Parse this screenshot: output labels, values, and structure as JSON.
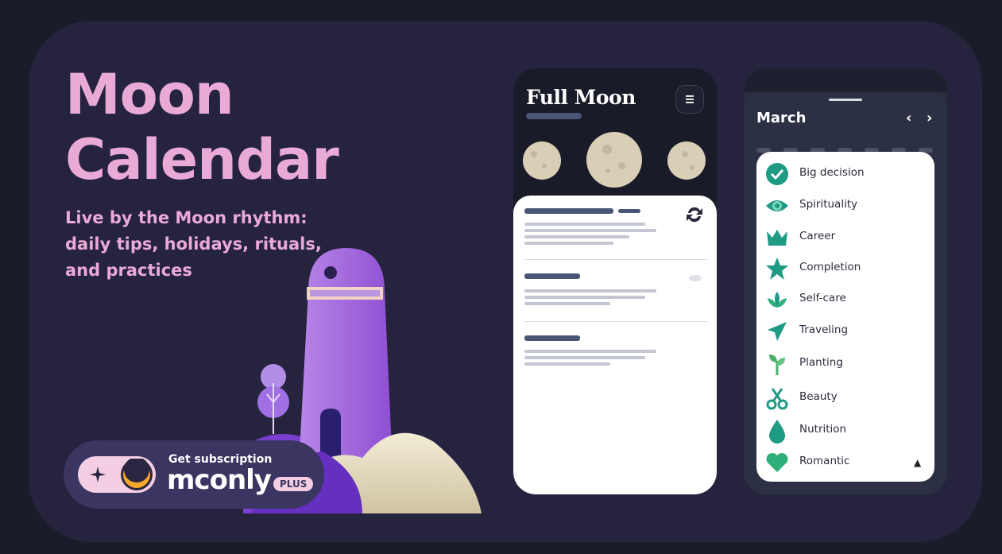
{
  "hero": {
    "title": "Moon\nCalendar",
    "subtitle": "Live by the Moon rhythm:\ndaily tips, holidays, rituals,\nand practices"
  },
  "subscription": {
    "label": "Get subscription",
    "brand": "mconly",
    "badge": "PLUS"
  },
  "phone1": {
    "title": "Full Moon",
    "menu_icon": "hamburger-menu-icon",
    "refresh_icon": "sync-icon"
  },
  "phone2": {
    "month": "March",
    "prev_icon": "chevron-left",
    "next_icon": "chevron-right",
    "prev_label": "‹",
    "next_label": "›",
    "scroll_label": "▲",
    "categories": [
      {
        "label": "Big decision",
        "icon": "checkmark-icon",
        "color": "#1f9a83"
      },
      {
        "label": "Spirituality",
        "icon": "eye-icon",
        "color": "#1f9a83"
      },
      {
        "label": "Career",
        "icon": "crown-icon",
        "color": "#1f9a83"
      },
      {
        "label": "Completion",
        "icon": "star-icon",
        "color": "#1f9a83"
      },
      {
        "label": "Self-care",
        "icon": "lotus-icon",
        "color": "#1f9a83"
      },
      {
        "label": "Traveling",
        "icon": "airplane-icon",
        "color": "#1f9a83"
      },
      {
        "label": "Planting",
        "icon": "sprout-icon",
        "color": "#4ab06a"
      },
      {
        "label": "Beauty",
        "icon": "scissors-icon",
        "color": "#1f9a83"
      },
      {
        "label": "Nutrition",
        "icon": "droplet-icon",
        "color": "#1f9a83"
      },
      {
        "label": "Romantic",
        "icon": "heart-icon",
        "color": "#2fb07a"
      }
    ]
  },
  "colors": {
    "background": "#1b1c2a",
    "card": "#26233f",
    "accent_pink": "#eaaad7",
    "teal": "#1f9a83"
  }
}
